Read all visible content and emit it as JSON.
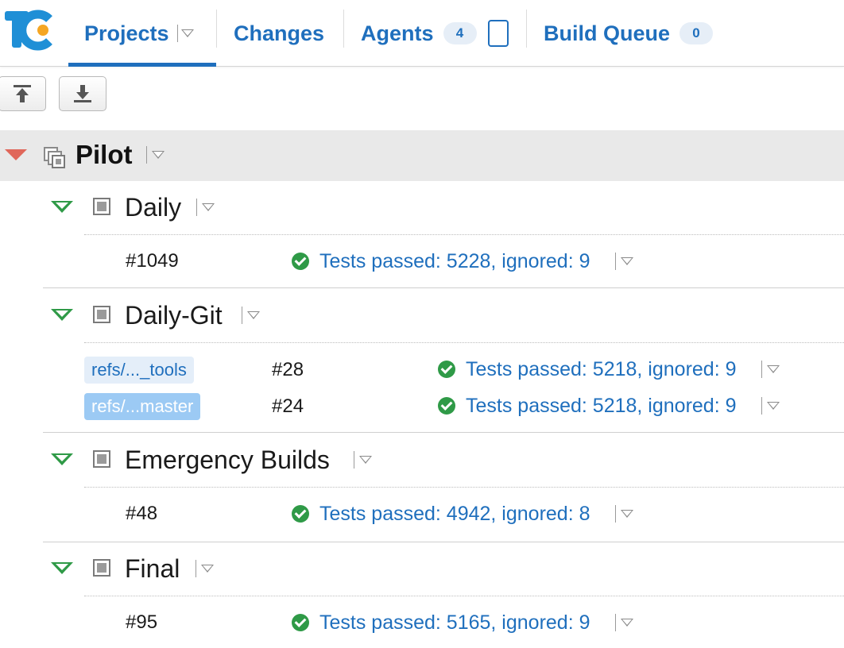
{
  "nav": {
    "logo_text": "TC",
    "projects": "Projects",
    "changes": "Changes",
    "agents": "Agents",
    "agents_count": "4",
    "build_queue": "Build Queue",
    "build_queue_count": "0"
  },
  "project": {
    "name": "Pilot"
  },
  "configs": [
    {
      "name": "Daily",
      "builds": [
        {
          "number": "#1049",
          "status": "Tests passed: 5228, ignored: 9"
        }
      ]
    },
    {
      "name": "Daily-Git",
      "builds": [
        {
          "branch": "refs/..._tools",
          "number": "#28",
          "status": "Tests passed: 5218, ignored: 9"
        },
        {
          "branch": "refs/...master",
          "number": "#24",
          "status": "Tests passed: 5218, ignored: 9"
        }
      ]
    },
    {
      "name": "Emergency Builds",
      "builds": [
        {
          "number": "#48",
          "status": "Tests passed: 4942, ignored: 8"
        }
      ]
    },
    {
      "name": "Final",
      "builds": [
        {
          "number": "#95",
          "status": "Tests passed: 5165, ignored: 9"
        }
      ]
    }
  ],
  "colors": {
    "accent": "#1f6fbd",
    "success": "#2f9a47",
    "collapse_arrow": "#e0675a",
    "project_header_bg": "#e9e9e9"
  }
}
